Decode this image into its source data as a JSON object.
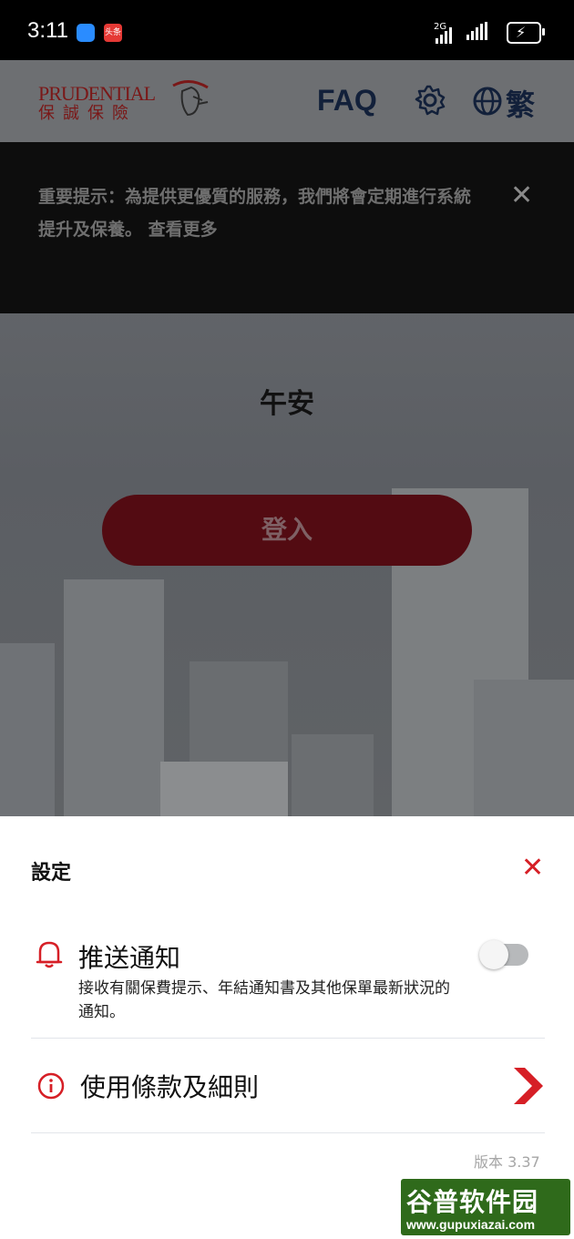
{
  "status_bar": {
    "time": "3:11",
    "app_icon_2_text": "头条",
    "network_label": "2G"
  },
  "header": {
    "logo_en": "PRUDENTIAL",
    "logo_zh": "保誠保險",
    "faq_label": "FAQ",
    "language_label": "繁"
  },
  "banner": {
    "text": "重要提示：為提供更優質的服務，我們將會定期進行系統提升及保養。 查看更多",
    "close_icon": "close-icon"
  },
  "main": {
    "greeting": "午安",
    "login_label": "登入"
  },
  "settings_sheet": {
    "title": "設定",
    "push": {
      "title": "推送通知",
      "description": "接收有關保費提示、年結通知書及其他保單最新狀況的通知。",
      "enabled": false
    },
    "terms_label": "使用條款及細則",
    "version": "版本 3.37"
  },
  "watermark": {
    "top": "谷普软件园",
    "bottom": "www.gupuxiazai.com"
  },
  "colors": {
    "accent_red": "#d61f26",
    "navy": "#12203a"
  }
}
